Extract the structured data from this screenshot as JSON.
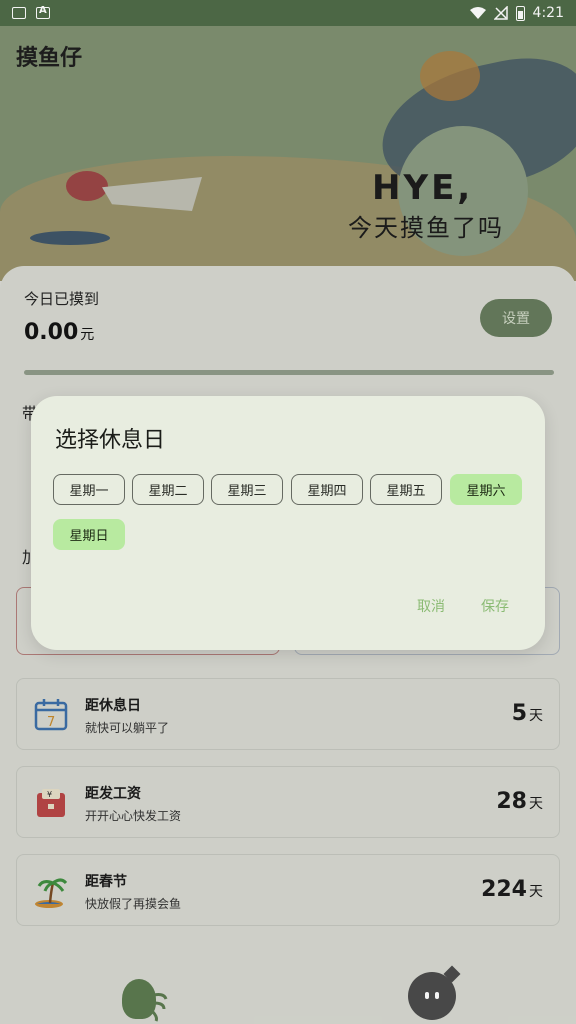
{
  "status_bar": {
    "time": "4:21"
  },
  "app": {
    "title": "摸鱼仔"
  },
  "banner": {
    "brand": "HYE,",
    "slogan": "今天摸鱼了吗"
  },
  "today": {
    "label": "今日已摸到",
    "value": "0.00",
    "unit": "元",
    "setting_label": "设置"
  },
  "behind": {
    "row_a": "带",
    "row_b": "加"
  },
  "countdowns": [
    {
      "title": "距休息日",
      "subtitle": "就快可以躺平了",
      "value": "5",
      "unit": "天",
      "icon": "calendar-icon"
    },
    {
      "title": "距发工资",
      "subtitle": "开开心心快发工资",
      "value": "28",
      "unit": "天",
      "icon": "wallet-icon"
    },
    {
      "title": "距春节",
      "subtitle": "快放假了再摸会鱼",
      "value": "224",
      "unit": "天",
      "icon": "palm-island-icon"
    }
  ],
  "dialog": {
    "title": "选择休息日",
    "days": [
      {
        "label": "星期一",
        "selected": false
      },
      {
        "label": "星期二",
        "selected": false
      },
      {
        "label": "星期三",
        "selected": false
      },
      {
        "label": "星期四",
        "selected": false
      },
      {
        "label": "星期五",
        "selected": false
      },
      {
        "label": "星期六",
        "selected": true
      },
      {
        "label": "星期日",
        "selected": true
      }
    ],
    "cancel": "取消",
    "save": "保存"
  },
  "colors": {
    "accent": "#8bbb74",
    "chip_selected": "#b8eaa0",
    "dialog_bg": "#e8ede0"
  }
}
